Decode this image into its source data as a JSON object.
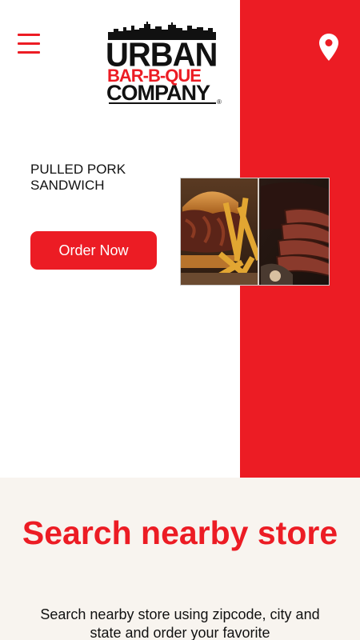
{
  "header": {
    "menu_icon": "hamburger-menu-icon",
    "location_icon": "map-pin-icon",
    "logo": {
      "line1": "URBAN",
      "line2": "BAR-B-QUE",
      "line3": "COMPANY",
      "reg_mark": "®"
    }
  },
  "hero": {
    "product_title": "PULLED PORK SANDWICH",
    "order_button": "Order Now",
    "image_name": "pulled-pork-sandwich-and-brisket-image"
  },
  "search": {
    "title": "Search nearby store",
    "description": "Search nearby store using zipcode, city and state and order your favorite"
  },
  "colors": {
    "brand_red": "#ec1c24",
    "text_dark": "#111111",
    "section_bg": "#f8f4ef"
  }
}
